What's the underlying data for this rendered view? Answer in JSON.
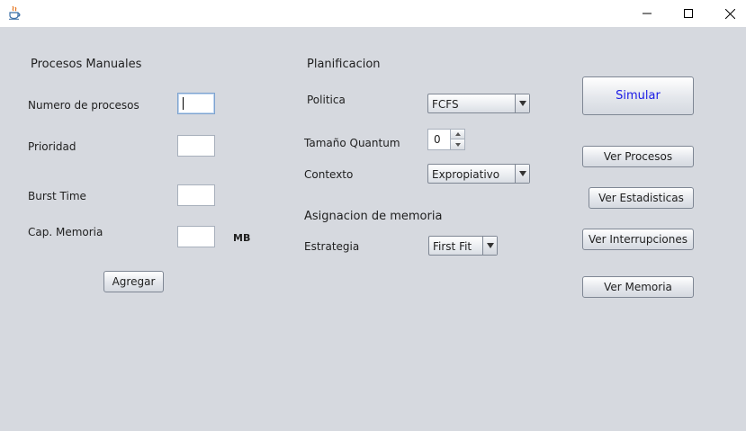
{
  "window": {
    "app_icon": "java-cup-icon",
    "controls": [
      "minimize-icon",
      "maximize-icon",
      "close-icon"
    ]
  },
  "manual": {
    "title": "Procesos Manuales",
    "num_procesos_label": "Numero de procesos",
    "num_procesos_value": "",
    "prioridad_label": "Prioridad",
    "prioridad_value": "",
    "burst_label": "Burst Time",
    "burst_value": "",
    "memoria_label": "Cap. Memoria",
    "memoria_value": "",
    "memoria_unit": "MB",
    "agregar_label": "Agregar"
  },
  "planificacion": {
    "title": "Planificacion",
    "politica_label": "Politica",
    "politica_value": "FCFS",
    "quantum_label": "Tamaño Quantum",
    "quantum_value": "0",
    "contexto_label": "Contexto",
    "contexto_value": "Expropiativo"
  },
  "asignacion": {
    "title": "Asignacion de memoria",
    "estrategia_label": "Estrategia",
    "estrategia_value": "First Fit"
  },
  "actions": {
    "simular": "Simular",
    "simular_color": "#1a1ae6",
    "ver_procesos": "Ver Procesos",
    "ver_estadisticas": "Ver Estadisticas",
    "ver_interrupciones": "Ver Interrupciones",
    "ver_memoria": "Ver Memoria"
  }
}
